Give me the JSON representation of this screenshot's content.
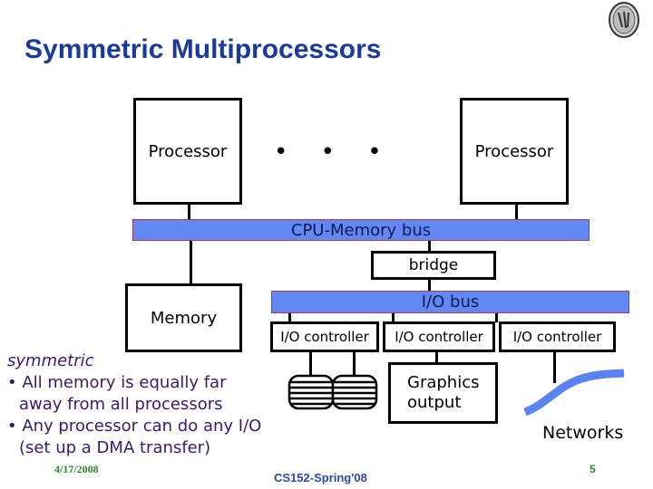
{
  "slide": {
    "title": "Symmetric Multiprocessors",
    "logo_icon": "university-seal-icon"
  },
  "diagram": {
    "processor_left": "Processor",
    "processor_right": "Processor",
    "ellipsis": "• • •",
    "cpu_memory_bus": "CPU-Memory bus",
    "bridge": "bridge",
    "memory": "Memory",
    "io_bus": "I/O bus",
    "io_controllers": [
      "I/O controller",
      "I/O controller",
      "I/O controller"
    ],
    "graphics_output_line1": "Graphics",
    "graphics_output_line2": "output",
    "networks": "Networks",
    "disk_icon": "disk-stack-icon",
    "network_icon": "network-cable-icon",
    "colors": {
      "bus_fill": "#6288f4",
      "bus_border": "#a23a5a",
      "title": "#1a3a9c",
      "notes": "#3a1a6a"
    }
  },
  "notes": {
    "heading": "symmetric",
    "bullets": [
      {
        "line1": "• All memory is equally far",
        "line2": "away from all processors"
      },
      {
        "line1": "• Any processor can do any I/O",
        "line2": "(set up a DMA transfer)"
      }
    ]
  },
  "footer": {
    "date": "4/17/2008",
    "course": "CS152-Spring'08",
    "page_number": "5"
  }
}
